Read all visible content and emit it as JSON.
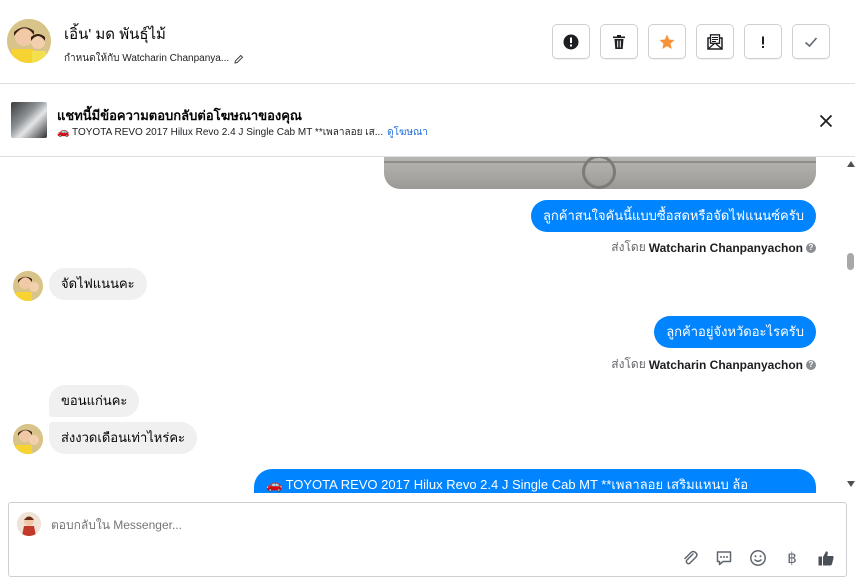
{
  "header": {
    "name": "เอิ้น' มด พันธุ์ไม้",
    "assigned": "กำหนดให้กับ Watcharin Chanpanya...",
    "actions": [
      {
        "name": "report-button",
        "icon": "alert-circle-icon"
      },
      {
        "name": "delete-button",
        "icon": "trash-icon"
      },
      {
        "name": "star-button",
        "icon": "star-icon"
      },
      {
        "name": "mark-unread-button",
        "icon": "envelope-icon"
      },
      {
        "name": "follow-up-button",
        "icon": "exclamation-icon"
      },
      {
        "name": "mark-done-button",
        "icon": "checkmark-icon"
      }
    ]
  },
  "ad": {
    "title": "แชทนี้มีข้อความตอบกลับต่อโฆษณาของคุณ",
    "description": "🚗 TOYOTA REVO 2017 Hilux Revo 2.4 J Single Cab MT **เพลาลอย เส...",
    "link": "ดูโฆษณา"
  },
  "messages": [
    {
      "id": "m1",
      "dir": "out",
      "text": "ลูกค้าสนใจคันนี้แบบซื้อสดหรือจัดไฟแนนซ์ครับ"
    },
    {
      "id": "m2",
      "dir": "in",
      "text": "จัดไฟแนนคะ"
    },
    {
      "id": "m3",
      "dir": "out",
      "text": "ลูกค้าอยู่จังหวัดอะไรครับ"
    },
    {
      "id": "m4",
      "dir": "in",
      "text": "ขอนแก่นคะ"
    },
    {
      "id": "m5",
      "dir": "in",
      "text": "ส่งงวดเดือนเท่าไหร่คะ"
    },
    {
      "id": "m6",
      "dir": "out",
      "text": "🚗 TOYOTA REVO 2017 Hilux Revo 2.4 J Single Cab MT **เพลาลอย เสริมแหนบ ล้อ"
    }
  ],
  "sent_by": {
    "prefix": "ส่งโดย",
    "name": "Watcharin Chanpanyachon"
  },
  "composer": {
    "placeholder": "ตอบกลับใน Messenger..."
  },
  "colors": {
    "outgoing": "#0084ff",
    "incoming": "#f0f0f0",
    "star": "#f7923b",
    "link": "#216fdb"
  }
}
